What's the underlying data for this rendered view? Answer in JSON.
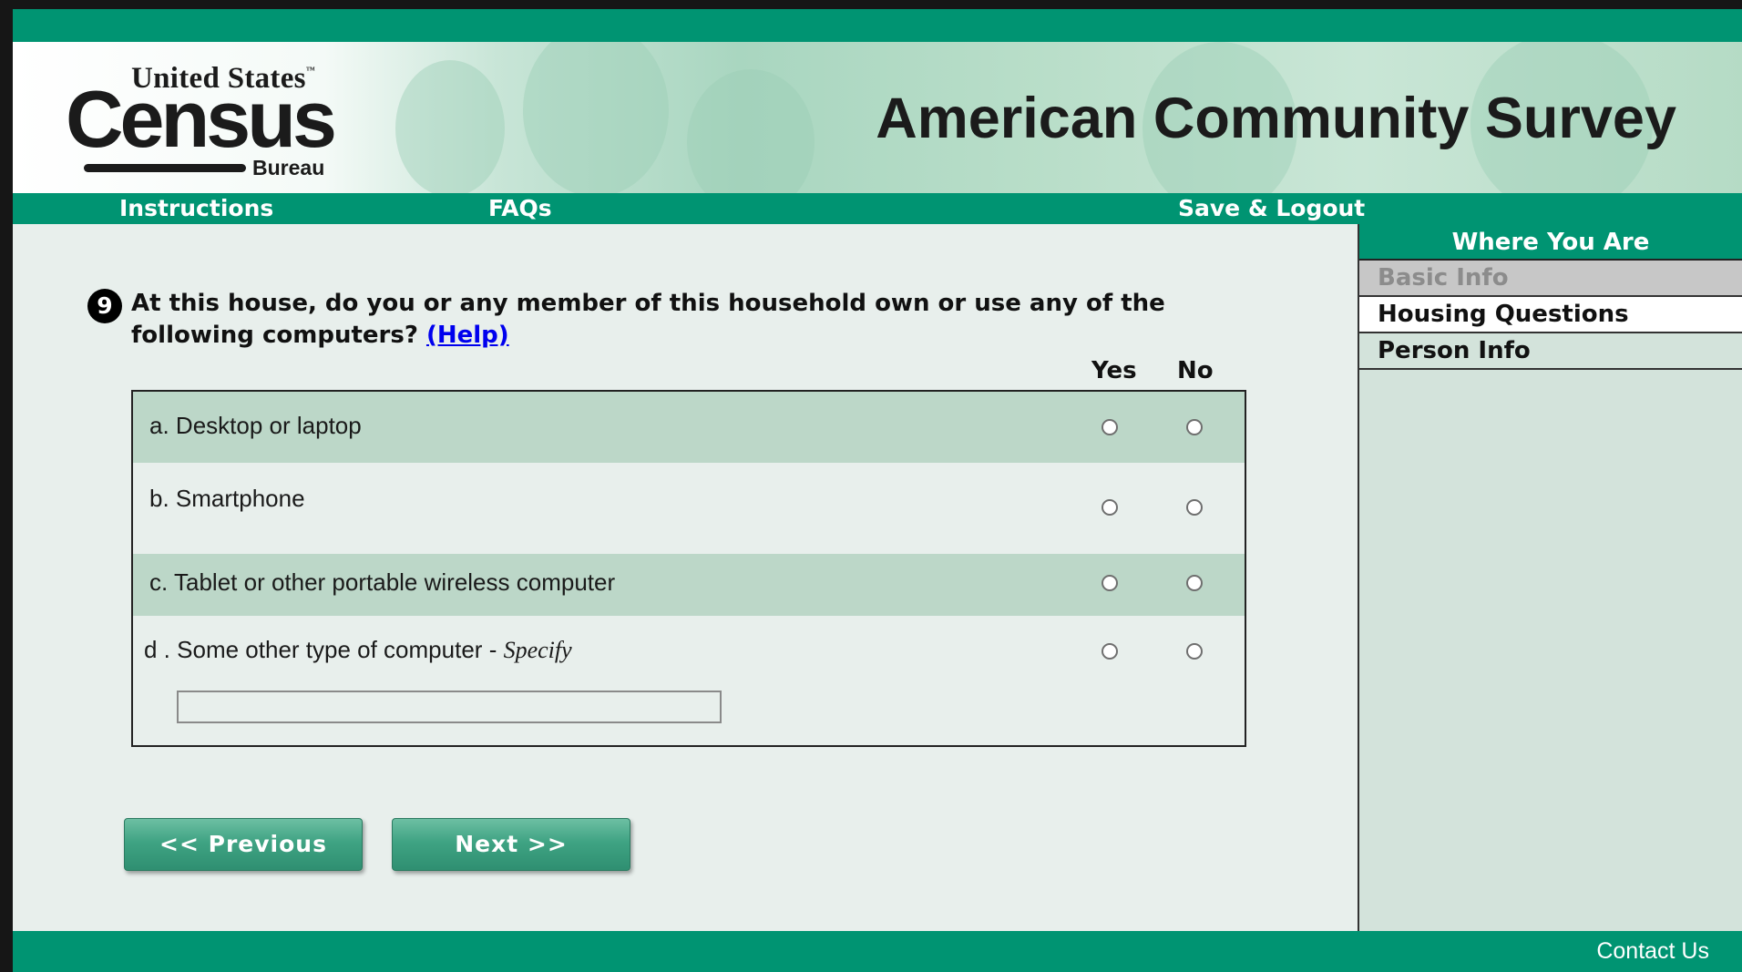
{
  "brand": {
    "logo_top": "United States",
    "logo_tm": "™",
    "logo_main": "Census",
    "logo_bottom": "Bureau",
    "survey_title": "American Community Survey"
  },
  "nav": {
    "instructions": "Instructions",
    "faqs": "FAQs",
    "save_logout": "Save & Logout"
  },
  "question": {
    "number": "9",
    "text": "At this house, do you or any member of this household own or use any of the following computers?",
    "help_label": "(Help)",
    "col_yes": "Yes",
    "col_no": "No",
    "items": [
      {
        "letter": "a.",
        "label": "Desktop or laptop"
      },
      {
        "letter": "b.",
        "label": "Smartphone"
      },
      {
        "letter": "c.",
        "label": "Tablet or other portable wireless computer"
      },
      {
        "letter": "d .",
        "label": "Some other type of computer",
        "sep": "-",
        "suffix": "Specify"
      }
    ],
    "specify_value": ""
  },
  "buttons": {
    "previous": "<<   Previous",
    "next": "Next   >>"
  },
  "sidebar": {
    "header": "Where You Are",
    "items": [
      {
        "label": "Basic Info",
        "state": "done"
      },
      {
        "label": "Housing Questions",
        "state": "current"
      },
      {
        "label": "Person Info",
        "state": "todo"
      }
    ]
  },
  "footer": {
    "contact": "Contact Us"
  },
  "colors": {
    "brand_green": "#009472",
    "row_shade": "#bcd7c8",
    "panel_bg": "#e8efec",
    "link_blue": "#0000ee"
  }
}
